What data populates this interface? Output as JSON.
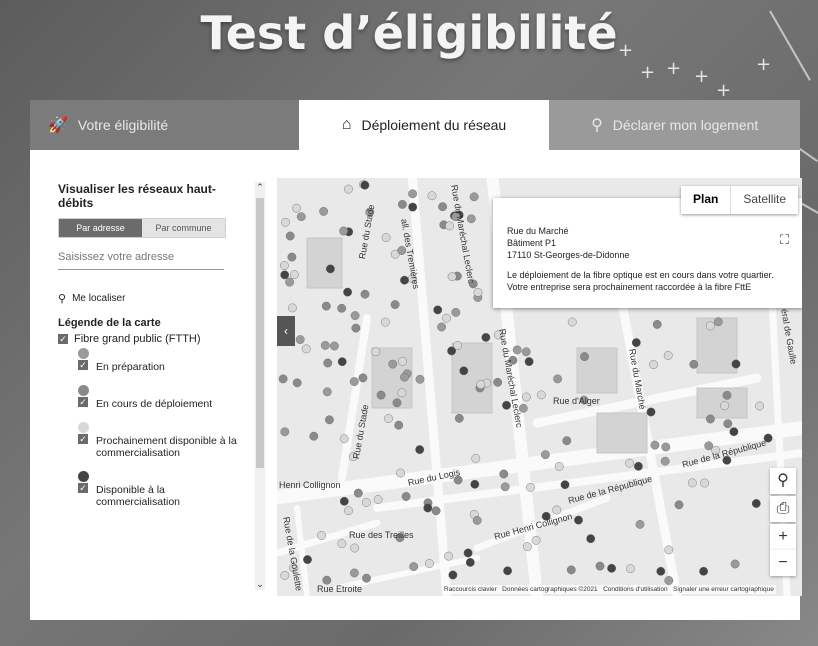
{
  "header": {
    "title": "Test d’éligibilité"
  },
  "tabs": [
    {
      "label": "Votre éligibilité",
      "icon": "rocket-icon"
    },
    {
      "label": "Déploiement du réseau",
      "icon": "home-icon"
    },
    {
      "label": "Déclarer mon logement",
      "icon": "map-pin-icon"
    }
  ],
  "sidebar": {
    "title": "Visualiser les réseaux haut-débits",
    "mode_address": "Par adresse",
    "mode_commune": "Par commune",
    "address_placeholder": "Saisissez votre adresse",
    "locate_label": "Me localiser",
    "legend_title": "Légende de la carte",
    "legend_main": "Fibre grand public (FTTH)",
    "legend_items": [
      {
        "label": "En préparation",
        "color": "#9a9a9a"
      },
      {
        "label": "En cours de déploiement",
        "color": "#8a8a8a"
      },
      {
        "label": "Prochainement disponible à la commercialisation",
        "color": "#d8d8d8"
      },
      {
        "label": "Disponible à la commercialisation",
        "color": "#444444"
      }
    ]
  },
  "map": {
    "view_plan": "Plan",
    "view_satellite": "Satellite",
    "popup": {
      "street": "Rue du Marché",
      "building": "Bâtiment P1",
      "city": "17110 St-Georges-de-Didonne",
      "message1": "Le déploiement de la fibre optique est en cours dans votre quartier.",
      "message2": "Votre entreprise sera prochainement raccordée à la fibre FttE"
    },
    "streets": {
      "stade": "Rue du Stade",
      "tremieres": "all. des Tremières",
      "leclerc": "Rue du Maréchal Leclerc",
      "leclerc2": "Rue du Maréchal Leclerc",
      "alger": "Rue d'Alger",
      "marche": "Rue du Marché",
      "logis": "Rue du Logis",
      "republique": "Rue de la République",
      "republique2": "Rue de la République",
      "collignon": "Henri Collignon",
      "collignon2": "Rue Henri Collignon",
      "treilles": "Rue des Treilles",
      "goulette": "Rue de la Goulette",
      "etroite": "Rue Etroite",
      "gaulle": "éral de Gaulle"
    },
    "attribution": {
      "shortcuts": "Raccourcis clavier",
      "data": "Données cartographiques ©2021",
      "terms": "Conditions d'utilisation",
      "report": "Signaler une erreur cartographique"
    }
  }
}
